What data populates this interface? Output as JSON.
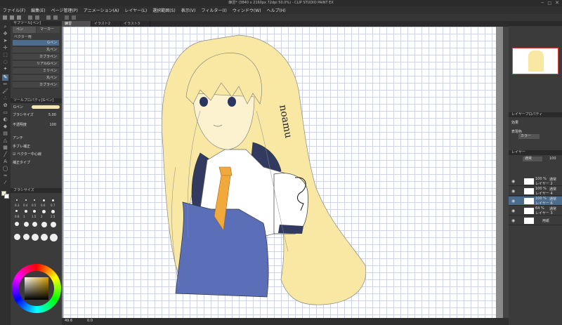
{
  "window": {
    "title": "練習* (3840 x 2160px 72dpi 50.0%) - CLIP STUDIO PAINT EX"
  },
  "menu": [
    "ファイル(F)",
    "編集(E)",
    "ページ管理(P)",
    "アニメーション(A)",
    "レイヤー(L)",
    "選択範囲(S)",
    "表示(V)",
    "フィルター(I)",
    "ウィンドウ(W)",
    "ヘルプ(H)"
  ],
  "tabs": [
    {
      "label": "練習",
      "active": true
    },
    {
      "label": "イラスト2",
      "active": false
    },
    {
      "label": "イラスト3",
      "active": false
    }
  ],
  "subtool": {
    "header": "サブツール[ペン]",
    "categories": [
      "ペン",
      "マーカー"
    ],
    "group": "ベクター用",
    "brushes": [
      "Gペン",
      "丸ペン",
      "カブラペン",
      "リアルGペン",
      "ミリペン",
      "丸ペン",
      "カブラペン"
    ],
    "selected_brush": 0
  },
  "tool_property": {
    "header": "ツールプロパティ[Gペン]",
    "name": "Gペン",
    "brush_size_label": "ブラシサイズ",
    "brush_size_value": "5.00",
    "opacity_label": "不透明度",
    "opacity_value": "100",
    "antialias_label": "アンチ",
    "stabilize_label": "手ブレ補正",
    "vector_label": "ベクター中心線",
    "correction_label": "補正タイプ"
  },
  "brush_size_panel": {
    "header": "ブラシサイズ",
    "sizes": [
      "0.3",
      "0.4",
      "0.5",
      "0.6",
      "0.7",
      "0.8",
      "1",
      "1.5",
      "2",
      "2.5",
      "3",
      "4",
      "5",
      "6",
      "7",
      "8",
      "10",
      "12",
      "15",
      "17",
      "20",
      "25",
      "30",
      "40"
    ]
  },
  "color": {
    "main": "#f7f2c4",
    "sub": "#ffffff",
    "hue": "#d4a000"
  },
  "status": {
    "zoom": "49.6",
    "angle": "0.0"
  },
  "layer_property": {
    "header": "レイヤープロパティ",
    "effect_label": "効果",
    "expression_label": "表現色",
    "expression_value": "カラー"
  },
  "layers": {
    "header": "レイヤー",
    "blend": "通常",
    "opacity": "100",
    "items": [
      {
        "pct": "100 %",
        "mode": "通常",
        "name": "レイヤー 2"
      },
      {
        "pct": "100 %",
        "mode": "通常",
        "name": "レイヤー 4"
      },
      {
        "pct": "100 %",
        "mode": "通常",
        "name": "レイヤー 6"
      },
      {
        "pct": "64 %",
        "mode": "通常",
        "name": "レイヤー 3"
      },
      {
        "pct": "",
        "mode": "",
        "name": "用紙"
      }
    ],
    "selected": 2
  },
  "drawing": {
    "signature": "noamu",
    "hair_color": "#f8e8a4",
    "skirt_color": "#5a6fb8",
    "tie_color": "#f0a93a",
    "vest_color": "#323a60"
  }
}
